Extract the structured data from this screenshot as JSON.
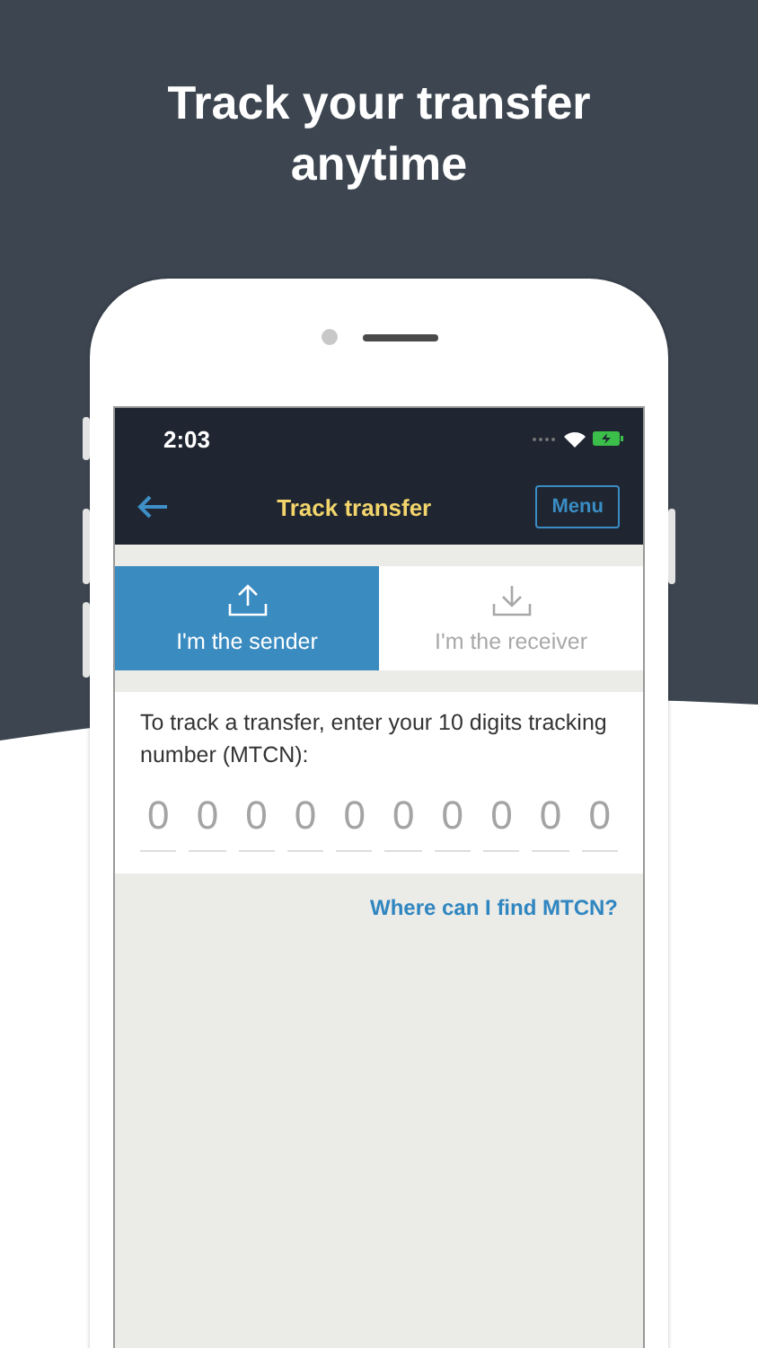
{
  "headline": {
    "line_1": "Track your transfer",
    "line_2": "anytime"
  },
  "status_bar": {
    "time": "2:03"
  },
  "nav_bar": {
    "title": "Track transfer",
    "menu": "Menu"
  },
  "tabs": [
    {
      "label": "I'm the sender",
      "kind": "upload",
      "selected": true
    },
    {
      "label": "I'm the receiver",
      "kind": "download",
      "selected": false
    }
  ],
  "instruction": "To track a transfer, enter your 10 digits tracking number (MTCN):",
  "digit_fields": [
    {
      "placeholder": "0"
    },
    {
      "placeholder": "0"
    },
    {
      "placeholder": "0"
    },
    {
      "placeholder": "0"
    },
    {
      "placeholder": "0"
    },
    {
      "placeholder": "0"
    },
    {
      "placeholder": "0"
    },
    {
      "placeholder": "0"
    },
    {
      "placeholder": "0"
    },
    {
      "placeholder": "0"
    }
  ],
  "help_link": "Where can I find MTCN?"
}
